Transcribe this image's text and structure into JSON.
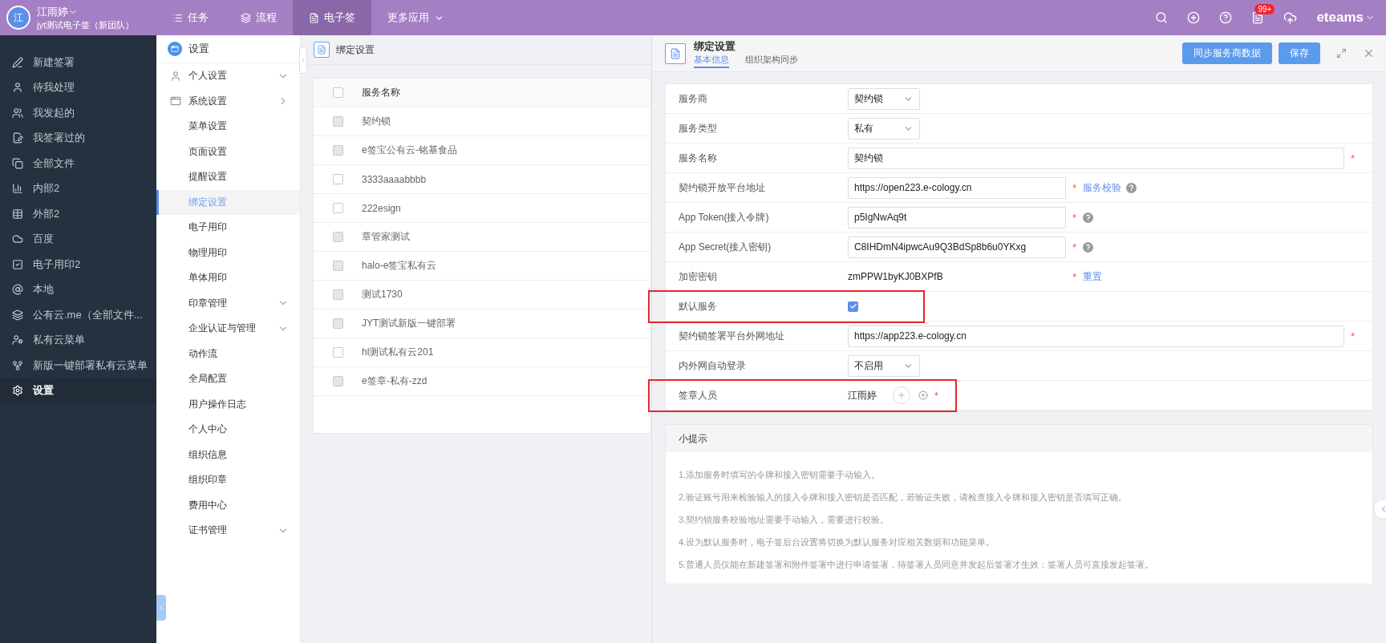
{
  "topbar": {
    "avatar": "江",
    "user": "江雨婷",
    "team": "jyt测试电子签（新团队）",
    "nav": [
      {
        "label": "任务",
        "kind": "list",
        "selected": false
      },
      {
        "label": "流程",
        "kind": "layers",
        "selected": false
      },
      {
        "label": "电子签",
        "kind": "doc",
        "selected": true
      },
      {
        "label": "更多应用",
        "kind": "more",
        "selected": false
      }
    ],
    "badge": "99+",
    "brand": "eteams"
  },
  "sidebar": {
    "items": [
      {
        "label": "新建签署",
        "selected": false
      },
      {
        "label": "待我处理",
        "selected": false
      },
      {
        "label": "我发起的",
        "selected": false
      },
      {
        "label": "我签署过的",
        "selected": false
      },
      {
        "label": "全部文件",
        "selected": false
      },
      {
        "label": "内部2",
        "selected": false
      },
      {
        "label": "外部2",
        "selected": false
      },
      {
        "label": "百度",
        "selected": false
      },
      {
        "label": "电子用印2",
        "selected": false
      },
      {
        "label": "本地",
        "selected": false
      },
      {
        "label": "公有云.me（全部文件...",
        "selected": false
      },
      {
        "label": "私有云菜单",
        "selected": false
      },
      {
        "label": "新版一键部署私有云菜单",
        "selected": false
      },
      {
        "label": "设置",
        "selected": true
      }
    ]
  },
  "settings_menu": {
    "title": "设置",
    "items": [
      {
        "label": "个人设置",
        "kind": "group",
        "expanded": false,
        "selected": false
      },
      {
        "label": "系统设置",
        "kind": "group",
        "expanded": true,
        "selected": false
      },
      {
        "label": "菜单设置",
        "selected": false
      },
      {
        "label": "页面设置",
        "selected": false
      },
      {
        "label": "提醒设置",
        "selected": false
      },
      {
        "label": "绑定设置",
        "selected": true
      },
      {
        "label": "电子用印",
        "selected": false
      },
      {
        "label": "物理用印",
        "selected": false
      },
      {
        "label": "单体用印",
        "selected": false
      },
      {
        "label": "印章管理",
        "kind": "group",
        "expanded": false,
        "selected": false
      },
      {
        "label": "企业认证与管理",
        "kind": "group",
        "expanded": false,
        "selected": false
      },
      {
        "label": "动作流",
        "selected": false
      },
      {
        "label": "全局配置",
        "selected": false
      },
      {
        "label": "用户操作日志",
        "selected": false
      },
      {
        "label": "个人中心",
        "selected": false
      },
      {
        "label": "组织信息",
        "selected": false
      },
      {
        "label": "组织印章",
        "selected": false
      },
      {
        "label": "费用中心",
        "selected": false
      },
      {
        "label": "证书管理",
        "kind": "group",
        "expanded": false,
        "selected": false
      }
    ]
  },
  "list": {
    "title": "绑定设置",
    "column": "服务名称",
    "all_checked": false,
    "rows": [
      {
        "name": "契约锁",
        "disabled": true
      },
      {
        "name": "e签宝公有云-铭基食品",
        "disabled": true
      },
      {
        "name": "3333aaaabbbb",
        "disabled": false
      },
      {
        "name": "222esign",
        "disabled": false
      },
      {
        "name": "章管家测试",
        "disabled": true
      },
      {
        "name": "halo-e签宝私有云",
        "disabled": true
      },
      {
        "name": "测试1730",
        "disabled": true
      },
      {
        "name": "JYT测试新版一键部署",
        "disabled": true
      },
      {
        "name": "hl测试私有云201",
        "disabled": false
      },
      {
        "name": "e签章-私有-zzd",
        "disabled": true
      }
    ]
  },
  "drawer": {
    "title": "绑定设置",
    "tabs": [
      {
        "label": "基本信息",
        "selected": true
      },
      {
        "label": "组织架构同步",
        "selected": false
      }
    ],
    "buttons": [
      "同步服务商数据",
      "保存"
    ],
    "fields": [
      {
        "label": "服务商",
        "kind": "select",
        "value": "契约锁",
        "highlighted": false
      },
      {
        "label": "服务类型",
        "kind": "select",
        "value": "私有",
        "highlighted": false
      },
      {
        "label": "服务名称",
        "kind": "wide",
        "value": "契约锁",
        "mark": "*",
        "highlighted": false
      },
      {
        "label": "契约锁开放平台地址",
        "kind": "input",
        "value": "https://open223.e-cology.cn",
        "mark": "*",
        "link": "服务校验",
        "help": true,
        "highlighted": false
      },
      {
        "label": "App Token(接入令牌)",
        "kind": "input",
        "value": "p5IgNwAq9t",
        "mark": "*",
        "help": true,
        "highlighted": false
      },
      {
        "label": "App Secret(接入密钥)",
        "kind": "input",
        "value": "C8IHDmN4ipwcAu9Q3BdSp8b6u0YKxg",
        "mark": "*",
        "help": true,
        "highlighted": false
      },
      {
        "label": "加密密钥",
        "kind": "text",
        "value": "zmPPW1byKJ0BXPfB",
        "mark": "*",
        "link": "重置",
        "highlighted": false
      },
      {
        "label": "默认服务",
        "kind": "checkbox",
        "checked": true,
        "highlighted": true
      },
      {
        "label": "契约锁签署平台外网地址",
        "kind": "wide",
        "value": "https://app223.e-cology.cn",
        "mark": "*",
        "highlighted": false
      },
      {
        "label": "内外网自动登录",
        "kind": "select",
        "value": "不启用",
        "highlighted": false
      },
      {
        "label": "签章人员",
        "kind": "person",
        "value": "江雨婷",
        "mark": "*",
        "highlighted": true
      }
    ],
    "tips": {
      "title": "小提示",
      "lines": [
        "1.添加服务时填写的令牌和接入密钥需要手动输入。",
        "2.验证账号用来检验输入的接入令牌和接入密钥是否匹配，若验证失败，请检查接入令牌和接入密钥是否填写正确。",
        "3.契约锁服务校验地址需要手动输入，需要进行校验。",
        "4.设为默认服务时，电子签后台设置将切换为默认服务对应相关数据和功能菜单。",
        "5.普通人员仅能在新建签署和附件签署中进行申请签署，待签署人员同意并发起后签署才生效；签署人员可直接发起签署。"
      ]
    }
  }
}
